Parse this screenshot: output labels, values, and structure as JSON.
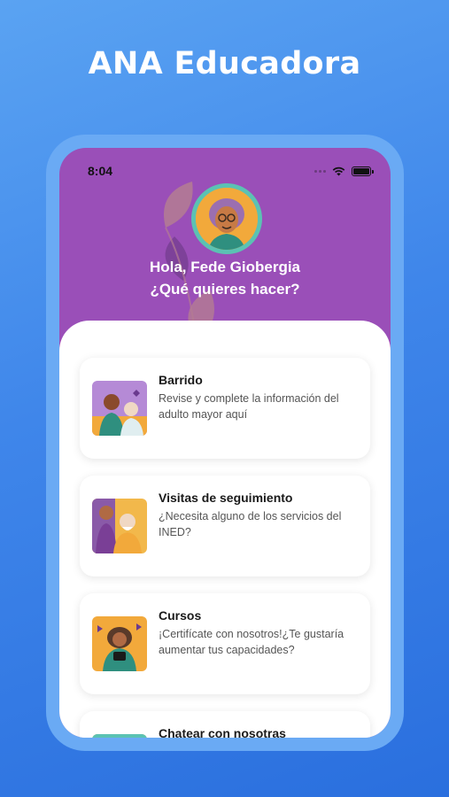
{
  "promo": {
    "title": "ANA Educadora"
  },
  "status_bar": {
    "time": "8:04"
  },
  "header": {
    "greeting_line1": "Hola, Fede Giobergia",
    "greeting_line2": "¿Qué quieres hacer?"
  },
  "cards": [
    {
      "title": "Barrido",
      "description": "Revise y complete la información del adulto mayor aquí"
    },
    {
      "title": "Visitas de seguimiento",
      "description": "¿Necesita alguno de los servicios del INED?"
    },
    {
      "title": "Cursos",
      "description": "¡Certifícate con nosotros!¿Te gustaría aumentar tus capacidades?"
    },
    {
      "title": "Chatear con nosotras",
      "description": ""
    }
  ],
  "colors": {
    "background": "#3f86ea",
    "phone_frame": "#6aaaf4",
    "header_purple": "#9a4fb8",
    "avatar_ring": "#5bc2b3"
  }
}
